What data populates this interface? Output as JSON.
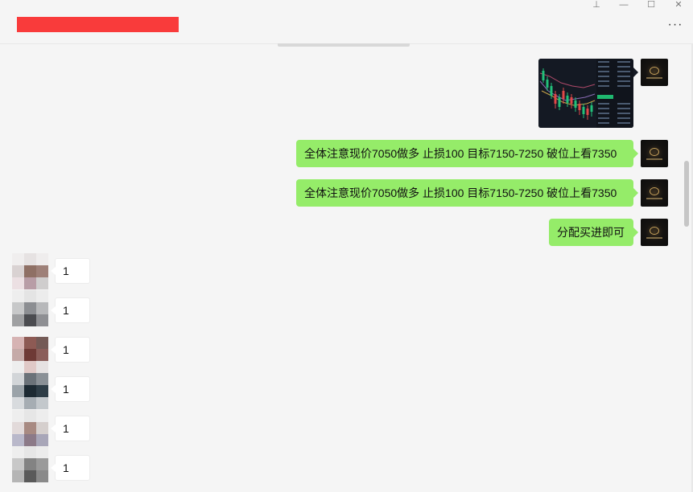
{
  "window": {
    "title": "",
    "controls": {
      "pin": "⊥",
      "minimize": "—",
      "maximize": "☐",
      "close": "✕"
    },
    "more_label": "···"
  },
  "colors": {
    "self_bubble": "#95ec69",
    "title_redaction": "#f93b3b"
  },
  "messages_out": [
    {
      "type": "image",
      "icon": "candlestick-chart-screenshot"
    },
    {
      "type": "text",
      "text": "全体注意现价7050做多 止损100  目标7150-7250 破位上看7350"
    },
    {
      "type": "text",
      "text": "全体注意现价7050做多 止损100  目标7150-7250 破位上看7350"
    },
    {
      "type": "text",
      "text": "分配买进即可"
    }
  ],
  "messages_in": [
    {
      "text": "1"
    },
    {
      "text": "1"
    },
    {
      "text": "1"
    },
    {
      "text": "1"
    },
    {
      "text": "1"
    },
    {
      "text": "1"
    }
  ]
}
